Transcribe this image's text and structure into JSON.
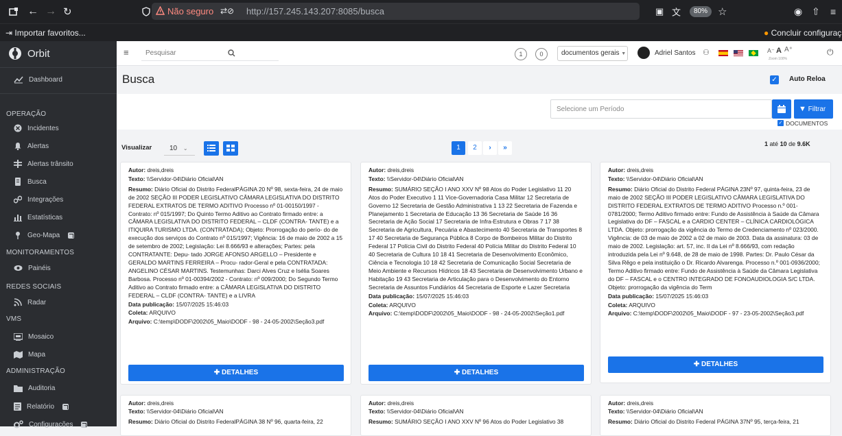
{
  "browser": {
    "security_label": "Não seguro",
    "url": "http://157.245.143.207:8085/busca",
    "zoom": "80%",
    "bookmark_import": "Importar favoritos...",
    "finish_setup": "Concluir configuraç"
  },
  "app": {
    "name": "Orbit",
    "brand_color": "#1a73e8",
    "sidebar_bg": "#2b2d31"
  },
  "sidebar": {
    "dashboard": "Dashboard",
    "sections": [
      {
        "title": "OPERAÇÃO",
        "items": [
          "Incidentes",
          "Alertas",
          "Alertas trânsito",
          "Busca",
          "Integrações",
          "Estatísticas",
          "Geo-Mapa"
        ]
      },
      {
        "title": "MONITORAMENTOS",
        "items": [
          "Painéis"
        ]
      },
      {
        "title": "REDES SOCIAIS",
        "items": [
          "Radar"
        ]
      },
      {
        "title": "VMS",
        "items": [
          "Mosaico",
          "Mapa"
        ]
      },
      {
        "title": "ADMINISTRAÇÃO",
        "items": [
          "Auditoria",
          "Relatório",
          "Configurações"
        ]
      }
    ]
  },
  "topbar": {
    "search_placeholder": "Pesquisar",
    "count1": "1",
    "count2": "0",
    "doc_select": "documentos gerais",
    "user": "Adriel Santos",
    "font_small": "A⁻",
    "font_normal": "A",
    "font_large": "A⁺",
    "zoom_caption": "Zoom 100%"
  },
  "page": {
    "title": "Busca",
    "auto_reload": "Auto Reloa"
  },
  "filter": {
    "period_placeholder": "Selecione um Período",
    "filter_btn": "Filtrar",
    "documents_check": "DOCUMENTOS"
  },
  "results": {
    "view_label": "Visualizar",
    "page_size": "10",
    "pages": [
      "1",
      "2"
    ],
    "count_prefix": "1",
    "count_mid": "até",
    "count_to": "10",
    "count_of": "de",
    "count_total": "9.6K"
  },
  "labels": {
    "autor": "Autor:",
    "texto": "Texto:",
    "resumo": "Resumo:",
    "data": "Data publicação:",
    "coleta": "Coleta:",
    "arquivo": "Arquivo:",
    "details": "DETALHES"
  },
  "cards": [
    {
      "autor": "dreis,dreis",
      "texto": "\\\\Servidor-04\\Diário Oficial\\AN",
      "resumo": "Diário Oficial do Distrito FederalPÁGINA 20 Nº 98, sexta-feira, 24 de maio de 2002 SEÇÃO III PODER LEGISLATIVO CÂMARA LEGISLATIVA DO DISTRITO FEDERAL EXTRATOS DE TERMO ADITIVO Processo nº 01-00150/1997 - Contrato: nº 015/1997; Do Quinto Termo Aditivo ao Contrato firmado entre: a CÂMARA LEGISLATIVA DO DISTRITO FEDERAL – CLDF (CONTRA- TANTE) e a ITIQUIRA TURISMO LTDA. (CONTRATADA); Objeto: Prorrogação do perío- do de execução dos serviços do Contrato nº 015/1997; Vigência: 16 de maio de 2002 a 15 de setembro de 2002; Legislação: Lei 8.666/93 e alterações; Partes: pela CONTRATANTE: Depu- tado JORGE AFONSO ARGELLO – Presidente e GERALDO MARTINS FERREIRA – Procu- rador-Geral e pela CONTRATADA: ANGELINO CÉSAR MARTINS. Testemunhas: Darci Alves Cruz e Isélia Soares Barbosa. Processo nº 01-00394/2002 - Contrato: nº 009/2000; Do Segundo Termo Aditivo ao Contrato firmado entre: a CÂMARA LEGISLATIVA DO DISTRITO FEDERAL – CLDF (CONTRA- TANTE) e a LIVRA",
      "data": "15/07/2025 15:46:03",
      "coleta": "ARQUIVO",
      "arquivo": "C:\\temp\\DODF\\2002\\05_Maio\\DODF - 98 - 24-05-2002\\Seção3.pdf"
    },
    {
      "autor": "dreis,dreis",
      "texto": "\\\\Servidor-04\\Diário Oficial\\AN",
      "resumo": "SUMÁRIO SEÇÃO I ANO XXV Nº 98 Atos do Poder Legislativo 11 20 Atos do Poder Executivo 1 11 Vice-Governadoria Casa Militar 12 Secretaria de Governo 12 Secretaria de Gestão Administrativa 1 13 22 Secretaria de Fazenda e Planejamento 1 Secretaria de Educação 13 36 Secretaria de Saúde 16 36 Secretaria de Ação Social 17 Secretaria de Infra-Estrutura e Obras 7 17 38 Secretaria de Agricultura, Pecuária e Abastecimento 40 Secretaria de Transportes 8 17 40 Secretaria de Segurança Pública 8 Corpo de Bombeiros Militar do Distrito Federal 17 Polícia Civil do Distrito Federal 40 Polícia Militar do Distrito Federal 10 40 Secretaria de Cultura 10 18 41 Secretaria de Desenvolvimento Econômico, Ciência e Tecnologia 10 18 42 Secretaria de Comunicação Social Secretaria de Meio Ambiente e Recursos Hídricos 18 43 Secretaria de Desenvolvimento Urbano e Habitação 19 43 Secretaria de Articulação para o Desenvolvimento do Entorno Secretaria de Assuntos Fundiários 44 Secretaria de Esporte e Lazer Secretaria",
      "data": "15/07/2025 15:46:03",
      "coleta": "ARQUIVO",
      "arquivo": "C:\\temp\\DODF\\2002\\05_Maio\\DODF - 98 - 24-05-2002\\Seção1.pdf"
    },
    {
      "autor": "dreis,dreis",
      "texto": "\\\\Servidor-04\\Diário Oficial\\AN",
      "resumo": "Diário Oficial do Distrito Federal PÁGINA 23Nº 97, quinta-feira, 23 de maio de 2002 SEÇÃO III PODER LEGISLATIVO CÂMARA LEGISLATIVA DO DISTRITO FEDERAL EXTRATOS DE TERMO ADITIVO Processo n.º 001-0781/2000; Termo Aditivo firmado entre: Fundo de Assistência à Saúde da Câmara Legislativa do DF – FASCAL e a CARDIO CENTER – CLÍNICA CARDIOLÓGICA LTDA. Objeto: prorrogação da vigência do Termo de Credenciamento nº 023/2000. Vigência: de 03 de maio de 2002 a 02 de maio de 2003. Data da assinatura: 03 de maio de 2002. Legislação: art. 57, inc. II da Lei nº 8.666/93, com redação introduzida pela Lei nº 9.648, de 28 de maio de 1998. Partes: Dr. Paulo César da Silva Rêgo e pela instituição o Dr. Ricardo Alvarenga. Processo n.º 001-0936/2000; Termo Aditivo firmado entre: Fundo de Assistência à Saúde da Câmara Legislativa do DF – FASCAL e o CENTRO INTEGRADO DE FONOAUDIOLOGIA S/C LTDA. Objeto: prorrogação da vigência do Term",
      "data": "15/07/2025 15:46:03",
      "coleta": "ARQUIVO",
      "arquivo": "C:\\temp\\DODF\\2002\\05_Maio\\DODF - 97 - 23-05-2002\\Seção3.pdf"
    }
  ],
  "cards2": [
    {
      "autor": "dreis,dreis",
      "texto": "\\\\Servidor-04\\Diário Oficial\\AN",
      "resumo": "Diário Oficial do Distrito FederalPÁGINA 38 Nº 96, quarta-feira, 22"
    },
    {
      "autor": "dreis,dreis",
      "texto": "\\\\Servidor-04\\Diário Oficial\\AN",
      "resumo": "SUMÁRIO SEÇÃO I ANO XXV Nº 96 Atos do Poder Legislativo 38"
    },
    {
      "autor": "dreis,dreis",
      "texto": "\\\\Servidor-04\\Diário Oficial\\AN",
      "resumo": "Diário Oficial do Distrito Federal PÁGINA 37Nº 95, terça-feira, 21"
    }
  ]
}
